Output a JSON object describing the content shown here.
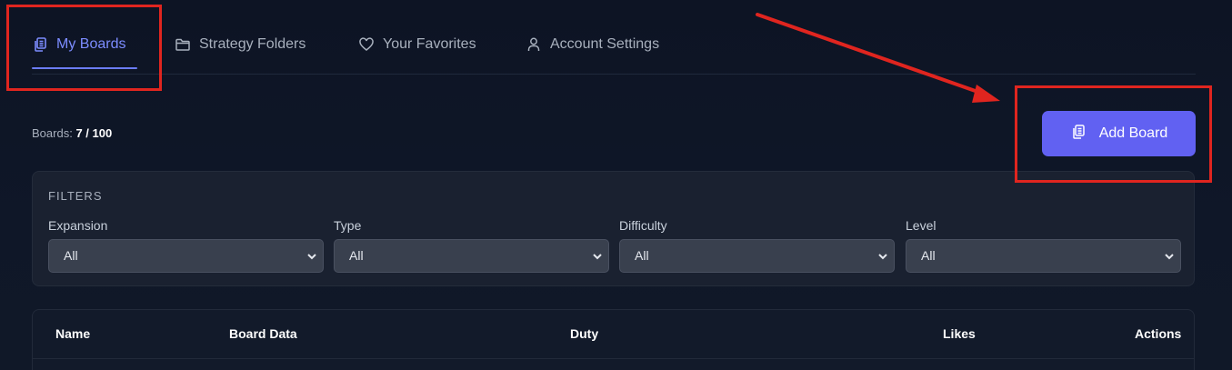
{
  "tabs": [
    {
      "label": "My Boards",
      "icon": "clipboard-stack-icon",
      "active": true
    },
    {
      "label": "Strategy Folders",
      "icon": "folder-icon",
      "active": false
    },
    {
      "label": "Your Favorites",
      "icon": "heart-icon",
      "active": false
    },
    {
      "label": "Account Settings",
      "icon": "user-icon",
      "active": false
    }
  ],
  "boards": {
    "label": "Boards:",
    "count": "7 / 100"
  },
  "add_board": {
    "label": "Add Board",
    "icon": "clipboard-stack-icon"
  },
  "filters": {
    "title": "FILTERS",
    "items": [
      {
        "label": "Expansion",
        "value": "All"
      },
      {
        "label": "Type",
        "value": "All"
      },
      {
        "label": "Difficulty",
        "value": "All"
      },
      {
        "label": "Level",
        "value": "All"
      }
    ]
  },
  "table": {
    "columns": [
      "Name",
      "Board Data",
      "Duty",
      "Likes",
      "Actions"
    ]
  },
  "colors": {
    "accent": "#6161f2",
    "active_tab": "#7c8cff",
    "highlight": "#e0251f",
    "background": "#0c1322"
  }
}
